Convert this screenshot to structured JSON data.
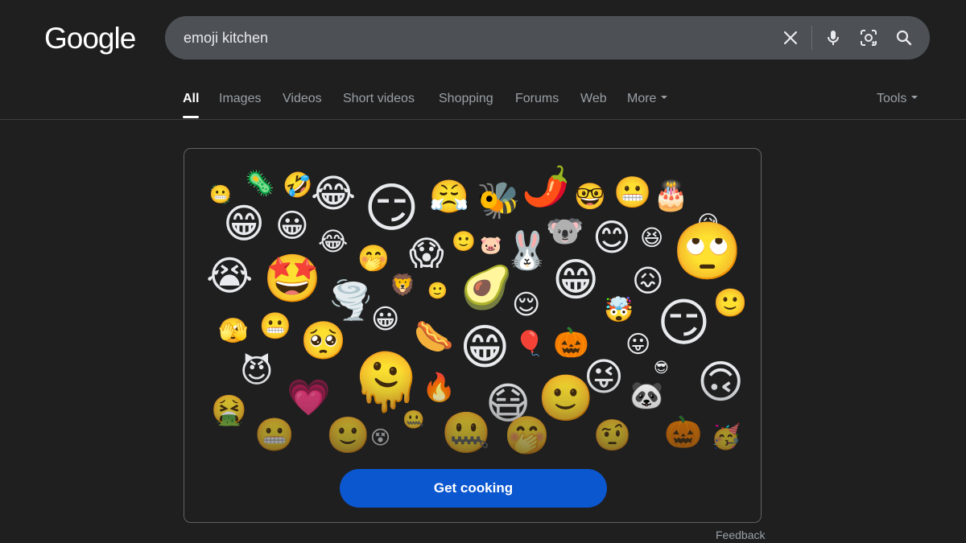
{
  "logo": "Google",
  "search": {
    "query": "emoji kitchen"
  },
  "tabs": [
    {
      "label": "All"
    },
    {
      "label": "Images"
    },
    {
      "label": "Videos"
    },
    {
      "label": "Short videos"
    },
    {
      "label": "Shopping"
    },
    {
      "label": "Forums"
    },
    {
      "label": "Web"
    },
    {
      "label": "More"
    }
  ],
  "tools_label": "Tools",
  "card": {
    "button_label": "Get cooking",
    "emojis": [
      "🦠",
      "🦠",
      "🤣",
      "😂",
      "😏",
      "😤",
      "🐝",
      "🌶️",
      "🤓",
      "😬",
      "🎂",
      "😁",
      "😀",
      "😂",
      "😥",
      "🤭",
      "😱",
      "🙂",
      "🐷",
      "🐰",
      "🐨",
      "😊",
      "😆",
      "🙄",
      "😭",
      "🤩",
      "🌪️",
      "🦁",
      "🙂",
      "🥑",
      "😁",
      "😖",
      "😌",
      "🤯",
      "🙂",
      "🫣",
      "😬",
      "🥺",
      "😀",
      "🌭",
      "😁",
      "🎈",
      "🎃",
      "😛",
      "😏",
      "😈",
      "🫠",
      "🔥",
      "😜",
      "😎",
      "🙃",
      "🤮",
      "💗",
      "🐼",
      "🙂",
      "😷",
      "🤐",
      "🤐",
      "😬",
      "🙂",
      "😵",
      "🤭",
      "🤨",
      "🎃",
      "🥳",
      "😬"
    ]
  },
  "feedback_label": "Feedback",
  "colors": {
    "accent": "#0b57d0",
    "background": "#1f1f1f",
    "searchbar": "#4d5156"
  }
}
